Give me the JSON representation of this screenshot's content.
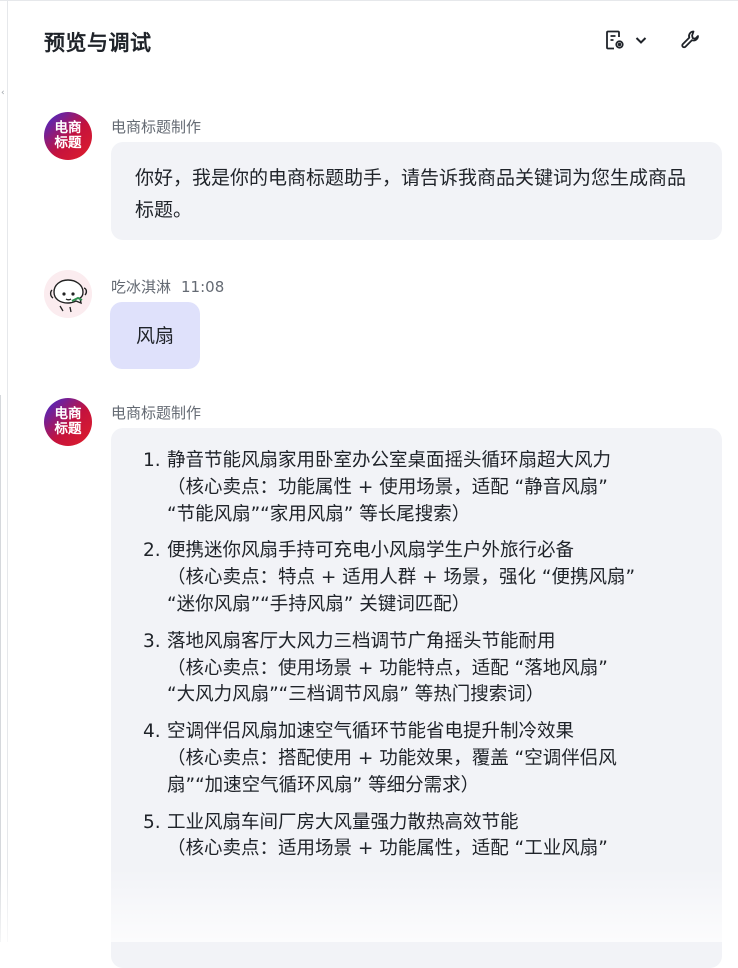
{
  "header": {
    "title": "预览与调试"
  },
  "conversation": {
    "messages": [
      {
        "sender": "电商标题制作",
        "avatar_text": [
          "电商",
          "标题"
        ],
        "text": "你好，我是你的电商标题助手，请告诉我商品关键词为您生成商品标题。"
      },
      {
        "sender": "吃冰淇淋",
        "time": "11:08",
        "text": "风扇"
      },
      {
        "sender": "电商标题制作",
        "avatar_text": [
          "电商",
          "标题"
        ],
        "items": [
          {
            "num": "1.",
            "lines": [
              "静音节能风扇家用卧室办公室桌面摇头循环扇超大风力",
              "（核心卖点：功能属性 + 使用场景，适配 “静音风扇”",
              "“节能风扇”“家用风扇” 等长尾搜索）"
            ]
          },
          {
            "num": "2.",
            "lines": [
              "便携迷你风扇手持可充电小风扇学生户外旅行必备",
              "（核心卖点：特点 + 适用人群 + 场景，强化 “便携风扇”",
              "“迷你风扇”“手持风扇” 关键词匹配）"
            ]
          },
          {
            "num": "3.",
            "lines": [
              "落地风扇客厅大风力三档调节广角摇头节能耐用",
              "（核心卖点：使用场景 + 功能特点，适配 “落地风扇”",
              "“大风力风扇”“三档调节风扇” 等热门搜索词）"
            ]
          },
          {
            "num": "4.",
            "lines": [
              "空调伴侣风扇加速空气循环节能省电提升制冷效果",
              "（核心卖点：搭配使用 + 功能效果，覆盖 “空调伴侣风",
              "扇”“加速空气循环风扇” 等细分需求）"
            ]
          },
          {
            "num": "5.",
            "lines": [
              "工业风扇车间厂房大风量强力散热高效节能",
              "（核心卖点：适用场景 + 功能属性，适配 “工业风扇”"
            ]
          }
        ]
      }
    ]
  },
  "icons": {
    "doc": "document-settings-icon",
    "chevron": "chevron-down-icon",
    "wrench": "wrench-icon"
  }
}
